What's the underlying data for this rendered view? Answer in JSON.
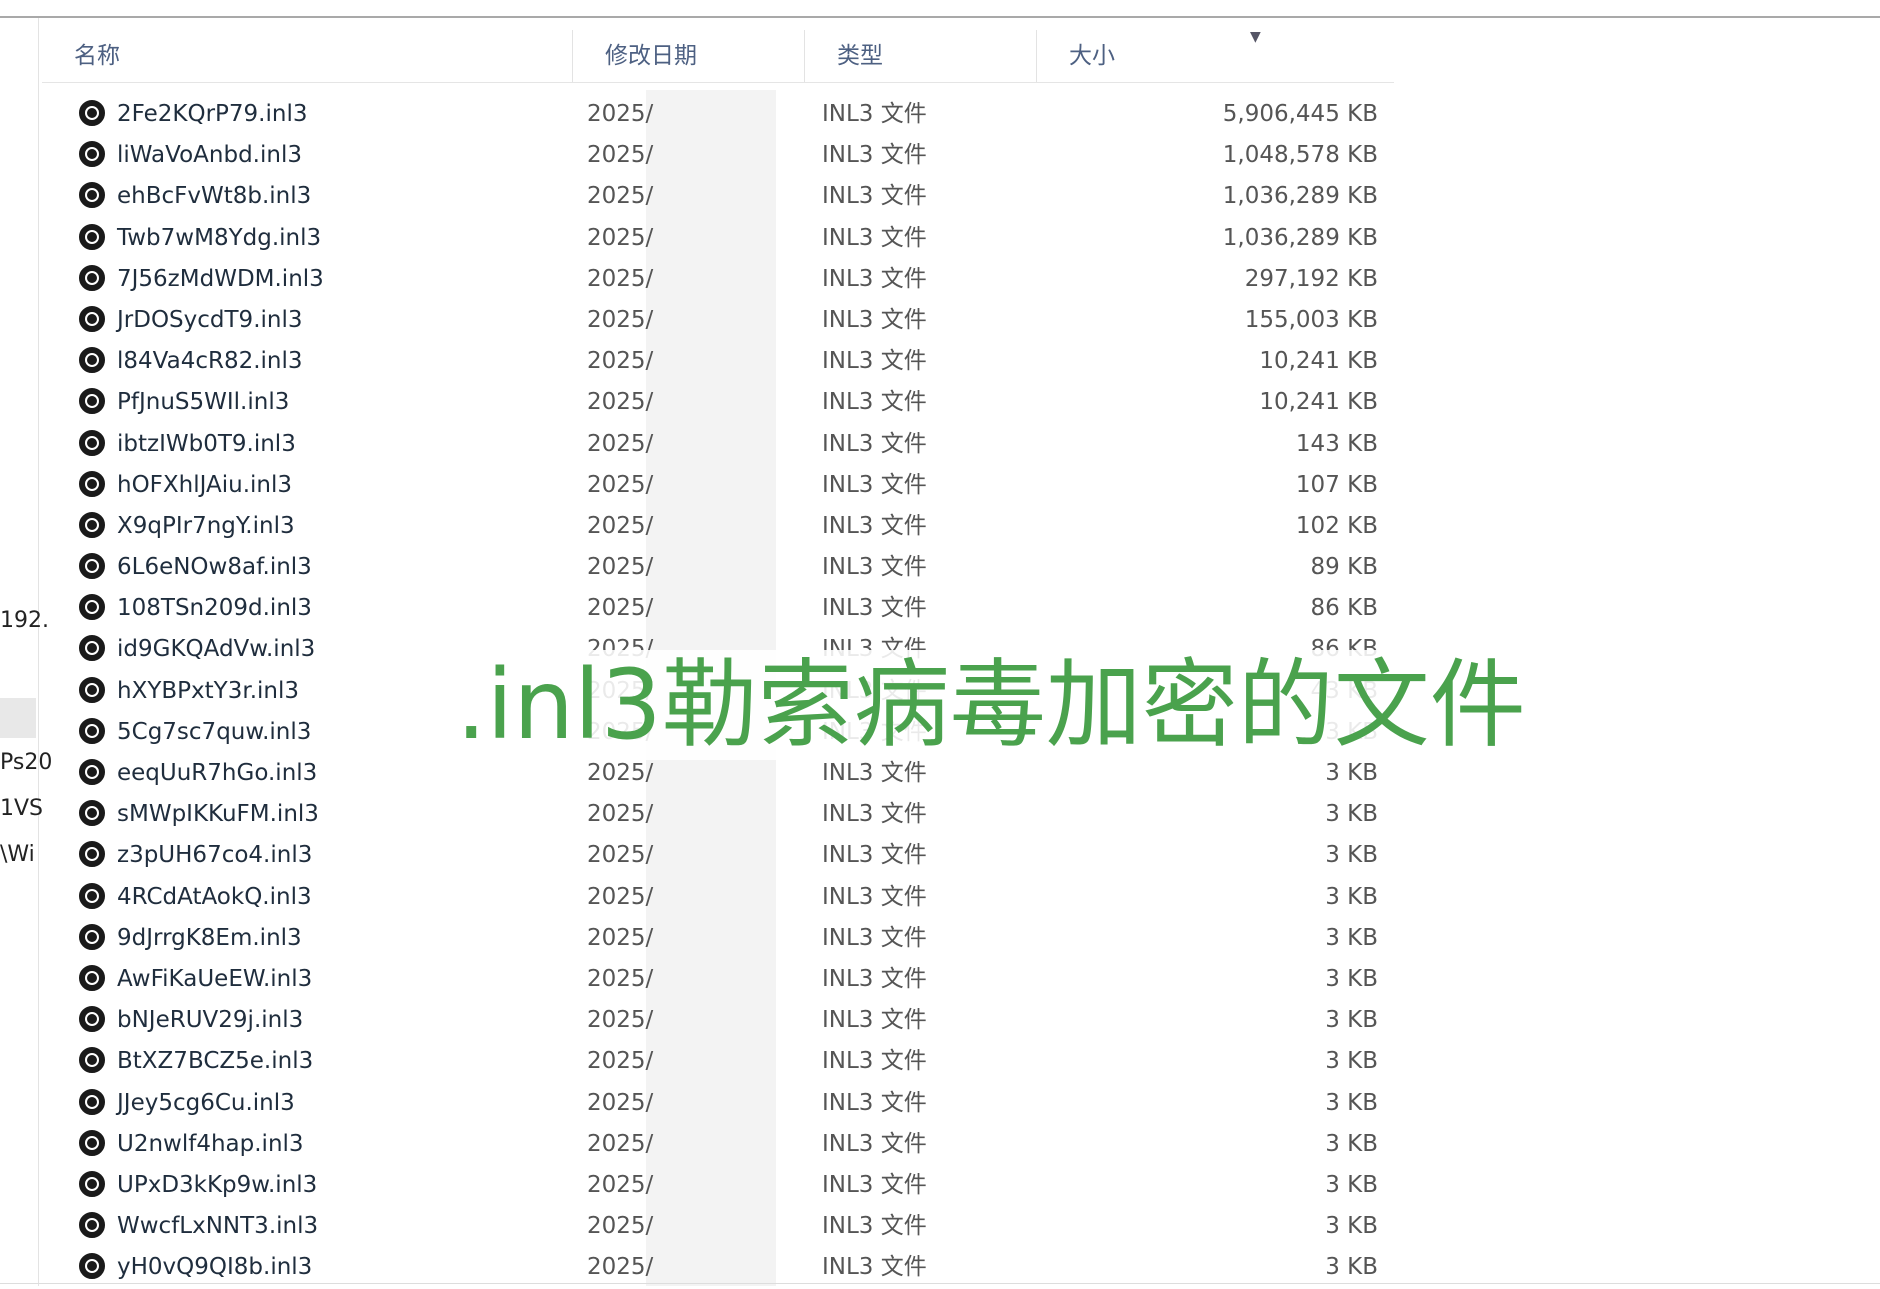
{
  "left_pane": {
    "fragments": [
      "192.",
      "Ps20",
      "1VS",
      "\\Wi"
    ]
  },
  "columns": {
    "name": "名称",
    "date": "修改日期",
    "type": "类型",
    "size": "大小"
  },
  "files": [
    {
      "name": "2Fe2KQrP79.inl3",
      "date": "2025/",
      "type": "INL3 文件",
      "size": "5,906,445 KB"
    },
    {
      "name": "liWaVoAnbd.inl3",
      "date": "2025/",
      "type": "INL3 文件",
      "size": "1,048,578 KB"
    },
    {
      "name": "ehBcFvWt8b.inl3",
      "date": "2025/",
      "type": "INL3 文件",
      "size": "1,036,289 KB"
    },
    {
      "name": "Twb7wM8Ydg.inl3",
      "date": "2025/",
      "type": "INL3 文件",
      "size": "1,036,289 KB"
    },
    {
      "name": "7J56zMdWDM.inl3",
      "date": "2025/",
      "type": "INL3 文件",
      "size": "297,192 KB"
    },
    {
      "name": "JrDOSycdT9.inl3",
      "date": "2025/",
      "type": "INL3 文件",
      "size": "155,003 KB"
    },
    {
      "name": "l84Va4cR82.inl3",
      "date": "2025/",
      "type": "INL3 文件",
      "size": "10,241 KB"
    },
    {
      "name": "PfJnuS5WIl.inl3",
      "date": "2025/",
      "type": "INL3 文件",
      "size": "10,241 KB"
    },
    {
      "name": "ibtzIWb0T9.inl3",
      "date": "2025/",
      "type": "INL3 文件",
      "size": "143 KB"
    },
    {
      "name": "hOFXhlJAiu.inl3",
      "date": "2025/",
      "type": "INL3 文件",
      "size": "107 KB"
    },
    {
      "name": "X9qPIr7ngY.inl3",
      "date": "2025/",
      "type": "INL3 文件",
      "size": "102 KB"
    },
    {
      "name": "6L6eNOw8af.inl3",
      "date": "2025/",
      "type": "INL3 文件",
      "size": "89 KB"
    },
    {
      "name": "108TSn209d.inl3",
      "date": "2025/",
      "type": "INL3 文件",
      "size": "86 KB"
    },
    {
      "name": "id9GKQAdVw.inl3",
      "date": "2025/",
      "type": "INL3 文件",
      "size": "86 KB"
    },
    {
      "name": "hXYBPxtY3r.inl3",
      "date": "2025/",
      "type": "INL3 文件",
      "size": "43 KB"
    },
    {
      "name": "5Cg7sc7quw.inl3",
      "date": "2025/",
      "type": "INL3 文件",
      "size": "3 KB"
    },
    {
      "name": "eeqUuR7hGo.inl3",
      "date": "2025/",
      "type": "INL3 文件",
      "size": "3 KB"
    },
    {
      "name": "sMWpIKKuFM.inl3",
      "date": "2025/",
      "type": "INL3 文件",
      "size": "3 KB"
    },
    {
      "name": "z3pUH67co4.inl3",
      "date": "2025/",
      "type": "INL3 文件",
      "size": "3 KB"
    },
    {
      "name": "4RCdAtAokQ.inl3",
      "date": "2025/",
      "type": "INL3 文件",
      "size": "3 KB"
    },
    {
      "name": "9dJrrgK8Em.inl3",
      "date": "2025/",
      "type": "INL3 文件",
      "size": "3 KB"
    },
    {
      "name": "AwFiKaUeEW.inl3",
      "date": "2025/",
      "type": "INL3 文件",
      "size": "3 KB"
    },
    {
      "name": "bNJeRUV29j.inl3",
      "date": "2025/",
      "type": "INL3 文件",
      "size": "3 KB"
    },
    {
      "name": "BtXZ7BCZ5e.inl3",
      "date": "2025/",
      "type": "INL3 文件",
      "size": "3 KB"
    },
    {
      "name": "JJey5cg6Cu.inl3",
      "date": "2025/",
      "type": "INL3 文件",
      "size": "3 KB"
    },
    {
      "name": "U2nwlf4hap.inl3",
      "date": "2025/",
      "type": "INL3 文件",
      "size": "3 KB"
    },
    {
      "name": "UPxD3kKp9w.inl3",
      "date": "2025/",
      "type": "INL3 文件",
      "size": "3 KB"
    },
    {
      "name": "WwcfLxNNT3.inl3",
      "date": "2025/",
      "type": "INL3 文件",
      "size": "3 KB"
    },
    {
      "name": "yH0vQ9QI8b.inl3",
      "date": "2025/",
      "type": "INL3 文件",
      "size": "3 KB"
    }
  ],
  "file_icon": "inl3-file-icon",
  "overlay": {
    "text": ".inl3勒索病毒加密的文件",
    "color": "#4aa24d"
  }
}
